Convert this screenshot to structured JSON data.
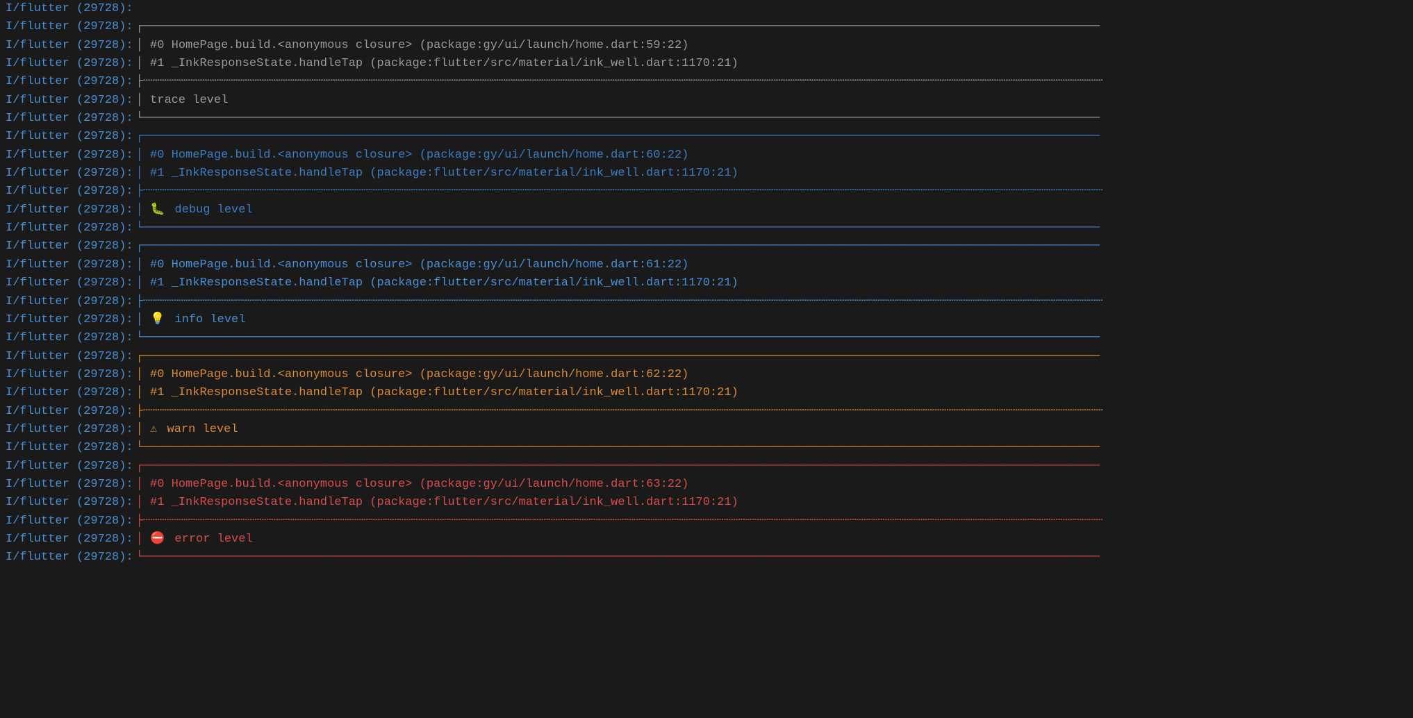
{
  "prefix": "I/flutter (29728):",
  "colors": {
    "bg": "#1a1a1a",
    "prefix": "#4a8fd6",
    "trace": "#9a9a9a",
    "debug": "#3b7dc4",
    "info": "#4a8fd6",
    "warn": "#d98a3a",
    "error": "#d94c4c"
  },
  "blocks": [
    {
      "level": "trace",
      "stack": [
        "#0   HomePage.build.<anonymous closure> (package:gy/ui/launch/home.dart:59:22)",
        "#1   _InkResponseState.handleTap (package:flutter/src/material/ink_well.dart:1170:21)"
      ],
      "label_icon": "",
      "label": "trace level"
    },
    {
      "level": "debug",
      "stack": [
        "#0   HomePage.build.<anonymous closure> (package:gy/ui/launch/home.dart:60:22)",
        "#1   _InkResponseState.handleTap (package:flutter/src/material/ink_well.dart:1170:21)"
      ],
      "label_icon": "🐛",
      "label": "debug level"
    },
    {
      "level": "info",
      "stack": [
        "#0   HomePage.build.<anonymous closure> (package:gy/ui/launch/home.dart:61:22)",
        "#1   _InkResponseState.handleTap (package:flutter/src/material/ink_well.dart:1170:21)"
      ],
      "label_icon": "💡",
      "label": "info level"
    },
    {
      "level": "warn",
      "stack": [
        "#0   HomePage.build.<anonymous closure> (package:gy/ui/launch/home.dart:62:22)",
        "#1   _InkResponseState.handleTap (package:flutter/src/material/ink_well.dart:1170:21)"
      ],
      "label_icon": "⚠",
      "label": "warn level"
    },
    {
      "level": "error",
      "stack": [
        "#0   HomePage.build.<anonymous closure> (package:gy/ui/launch/home.dart:63:22)",
        "#1   _InkResponseState.handleTap (package:flutter/src/material/ink_well.dart:1170:21)"
      ],
      "label_icon": "⛔",
      "label": "error level"
    }
  ],
  "box_chars": {
    "top_left": "┌",
    "vertical": "│",
    "tee": "├",
    "bottom_left": "└",
    "hline_solid": "─",
    "hline_dash": "┄"
  }
}
